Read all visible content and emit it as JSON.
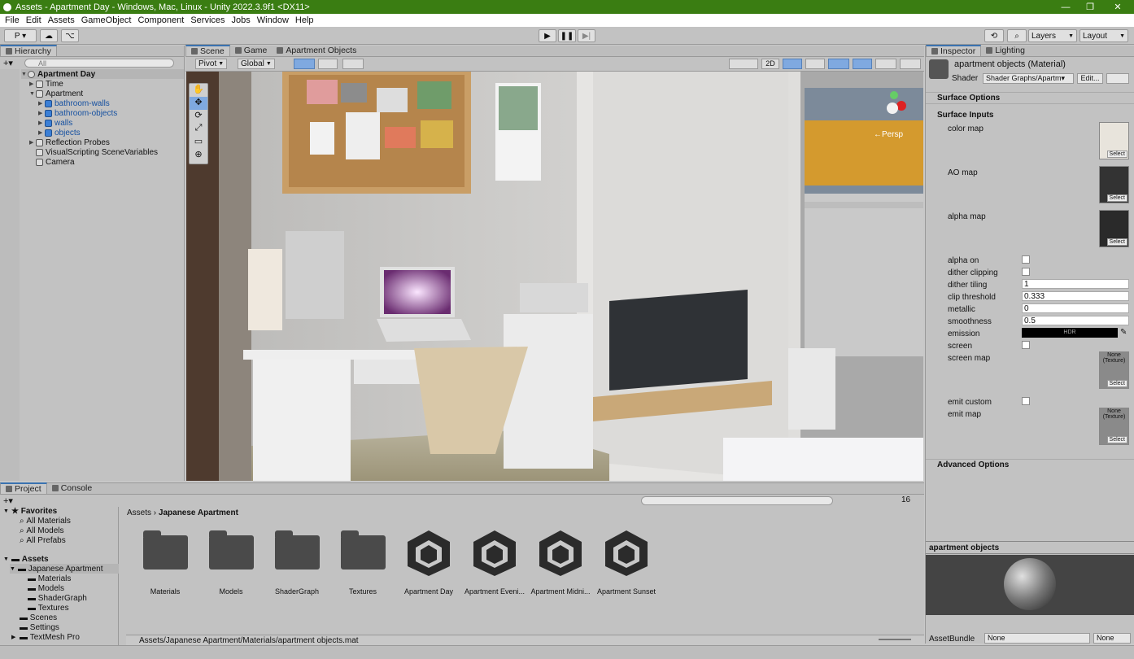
{
  "window": {
    "title": "Assets - Apartment Day - Windows, Mac, Linux - Unity 2022.3.9f1 <DX11>",
    "minimize": "—",
    "maximize": "❐",
    "close": "✕"
  },
  "menu": [
    "File",
    "Edit",
    "Assets",
    "GameObject",
    "Component",
    "Services",
    "Jobs",
    "Window",
    "Help"
  ],
  "toolbar": {
    "account": "P ▾",
    "layers": "Layers",
    "layout": "Layout"
  },
  "hierarchy": {
    "tab": "Hierarchy",
    "search_placeholder": "All",
    "items": [
      {
        "label": "Apartment Day",
        "indent": 0,
        "bold": true
      },
      {
        "label": "Time",
        "indent": 1
      },
      {
        "label": "Apartment",
        "indent": 1
      },
      {
        "label": "bathroom-walls",
        "indent": 2,
        "blue": true
      },
      {
        "label": "bathroom-objects",
        "indent": 2,
        "blue": true
      },
      {
        "label": "walls",
        "indent": 2,
        "blue": true
      },
      {
        "label": "objects",
        "indent": 2,
        "blue": true
      },
      {
        "label": "Reflection Probes",
        "indent": 1
      },
      {
        "label": "VisualScripting SceneVariables",
        "indent": 1
      },
      {
        "label": "Camera",
        "indent": 1
      }
    ]
  },
  "scene_tabs": [
    "Scene",
    "Game",
    "Apartment Objects"
  ],
  "scene_toolbar": {
    "pivot": "Pivot",
    "global": "Global",
    "mode2d": "2D",
    "persp": "←Persp"
  },
  "inspector": {
    "tabs": [
      "Inspector",
      "Lighting"
    ],
    "material_name": "apartment objects (Material)",
    "shader_label": "Shader",
    "shader_value": "Shader Graphs/Apartm▾",
    "edit": "Edit...",
    "surface_options": "Surface Options",
    "surface_inputs": "Surface Inputs",
    "advanced_options": "Advanced Options",
    "texture_props": [
      {
        "label": "color map",
        "select": "Select"
      },
      {
        "label": "AO map",
        "select": "Select"
      },
      {
        "label": "alpha map",
        "select": "Select"
      }
    ],
    "props": [
      {
        "label": "alpha on",
        "type": "check"
      },
      {
        "label": "dither clipping",
        "type": "check"
      },
      {
        "label": "dither tiling",
        "type": "field",
        "value": "1"
      },
      {
        "label": "clip threshold",
        "type": "field",
        "value": "0.333"
      },
      {
        "label": "metallic",
        "type": "field",
        "value": "0"
      },
      {
        "label": "smoothness",
        "type": "field",
        "value": "0.5"
      },
      {
        "label": "emission",
        "type": "hdr",
        "value": "HDR"
      },
      {
        "label": "screen",
        "type": "check"
      },
      {
        "label": "screen map",
        "type": "none"
      },
      {
        "label": "emit custom",
        "type": "check"
      },
      {
        "label": "emit map",
        "type": "none"
      }
    ],
    "none_texture": "None (Texture)",
    "preview_title": "apartment objects",
    "assetbundle_label": "AssetBundle",
    "assetbundle_value": "None",
    "assetbundle_variant": "None"
  },
  "project": {
    "tabs": [
      "Project",
      "Console"
    ],
    "breadcrumb_root": "Assets",
    "breadcrumb_current": "Japanese Apartment",
    "count": "16",
    "favorites_label": "Favorites",
    "favorites": [
      "All Materials",
      "All Models",
      "All Prefabs"
    ],
    "assets_label": "Assets",
    "tree": [
      {
        "label": "Japanese Apartment",
        "indent": 1,
        "selected": true
      },
      {
        "label": "Materials",
        "indent": 2
      },
      {
        "label": "Models",
        "indent": 2
      },
      {
        "label": "ShaderGraph",
        "indent": 2
      },
      {
        "label": "Textures",
        "indent": 2
      },
      {
        "label": "Scenes",
        "indent": 1
      },
      {
        "label": "Settings",
        "indent": 1
      },
      {
        "label": "TextMesh Pro",
        "indent": 1
      }
    ],
    "assets": [
      {
        "label": "Materials",
        "kind": "folder"
      },
      {
        "label": "Models",
        "kind": "folder"
      },
      {
        "label": "ShaderGraph",
        "kind": "folder"
      },
      {
        "label": "Textures",
        "kind": "folder"
      },
      {
        "label": "Apartment Day",
        "kind": "unity"
      },
      {
        "label": "Apartment Eveni...",
        "kind": "unity"
      },
      {
        "label": "Apartment Midni...",
        "kind": "unity"
      },
      {
        "label": "Apartment Sunset",
        "kind": "unity"
      }
    ],
    "status_path": "Assets/Japanese Apartment/Materials/apartment objects.mat"
  }
}
